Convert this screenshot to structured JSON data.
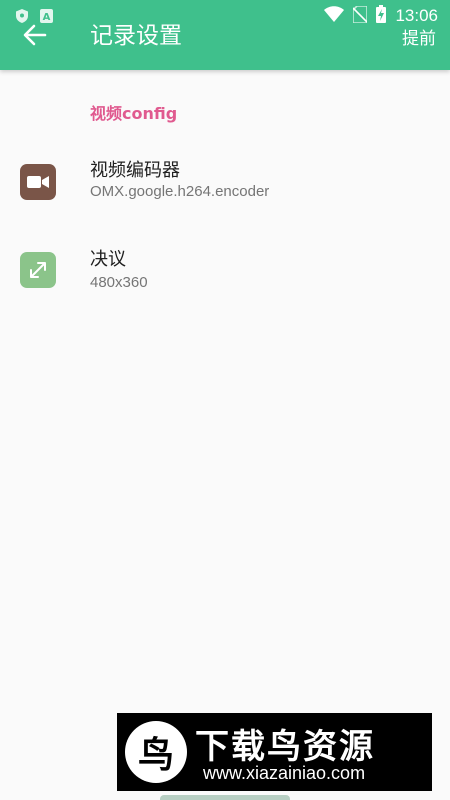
{
  "status_bar": {
    "time": "13:06",
    "left_icons": [
      "shield-icon",
      "letter-a-icon"
    ],
    "right_icons": [
      "wifi-icon",
      "no-sim-icon",
      "battery-charging-icon"
    ]
  },
  "app_bar": {
    "title": "记录设置",
    "action_label": "提前",
    "color": "#3fc08c"
  },
  "section": {
    "header": "视频config",
    "color": "#e05a8f"
  },
  "settings": [
    {
      "title": "视频编码器",
      "summary": "OMX.google.h264.encoder",
      "icon": "video-camera-icon",
      "icon_color": "#7a5548"
    },
    {
      "title": "决议",
      "summary": "480x360",
      "icon": "expand-arrows-icon",
      "icon_color": "#8bc48a"
    }
  ],
  "watermark": {
    "text": "下载鸟资源",
    "url": "www.xiazainiao.com",
    "logo_letter": "鸟"
  }
}
